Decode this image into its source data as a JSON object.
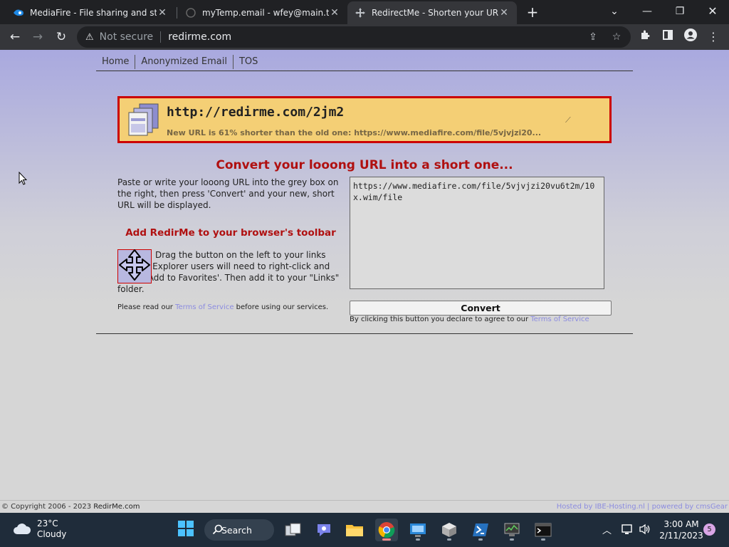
{
  "browser": {
    "tabs": [
      {
        "title": "MediaFire - File sharing and storage",
        "icon": "mediafire-icon"
      },
      {
        "title": "myTemp.email - wfey@main.truyo.com",
        "icon": "mytemp-icon"
      },
      {
        "title": "RedirectMe - Shorten your URL today",
        "icon": "redirme-icon"
      }
    ],
    "security_label": "Not secure",
    "url": "redirme.com"
  },
  "site": {
    "nav": [
      "Home",
      "Anonymized Email",
      "TOS"
    ],
    "result": {
      "short_url": "http://redirme.com/2jm2",
      "info": "New URL is 61% shorter than the old one: https://www.mediafire.com/file/5vjvjzi20..."
    },
    "headline": "Convert your looong URL into a short one...",
    "instructions": "Paste or write your looong URL into the grey box on the right, then press 'Convert' and your new, short URL will be displayed.",
    "toolbar_heading": "Add RedirMe to your browser's toolbar",
    "drag_text": "Drag the button on the left to your links toolbar. Explorer users will need to right-click and select 'Add to Favorites'. Then add it to your \"Links\" folder.",
    "tos_note_pre": "Please read our ",
    "tos_link": "Terms of Service",
    "tos_note_post": " before using our services.",
    "url_value": "https://www.mediafire.com/file/5vjvjzi20vu6t2m/10x.wim/file",
    "convert_label": "Convert",
    "agree_pre": "By clicking this button you declare to agree to our ",
    "footer_copy_pre": "© Copyright 2006 - 2023 ",
    "footer_copy_site": "RedirMe.com",
    "footer_hosted": "Hosted by IBE-Hosting.nl | powered by cmsGear"
  },
  "taskbar": {
    "temp": "23°C",
    "condition": "Cloudy",
    "search_label": "Search",
    "time": "3:00 AM",
    "date": "2/11/2023",
    "notification_count": "5"
  }
}
